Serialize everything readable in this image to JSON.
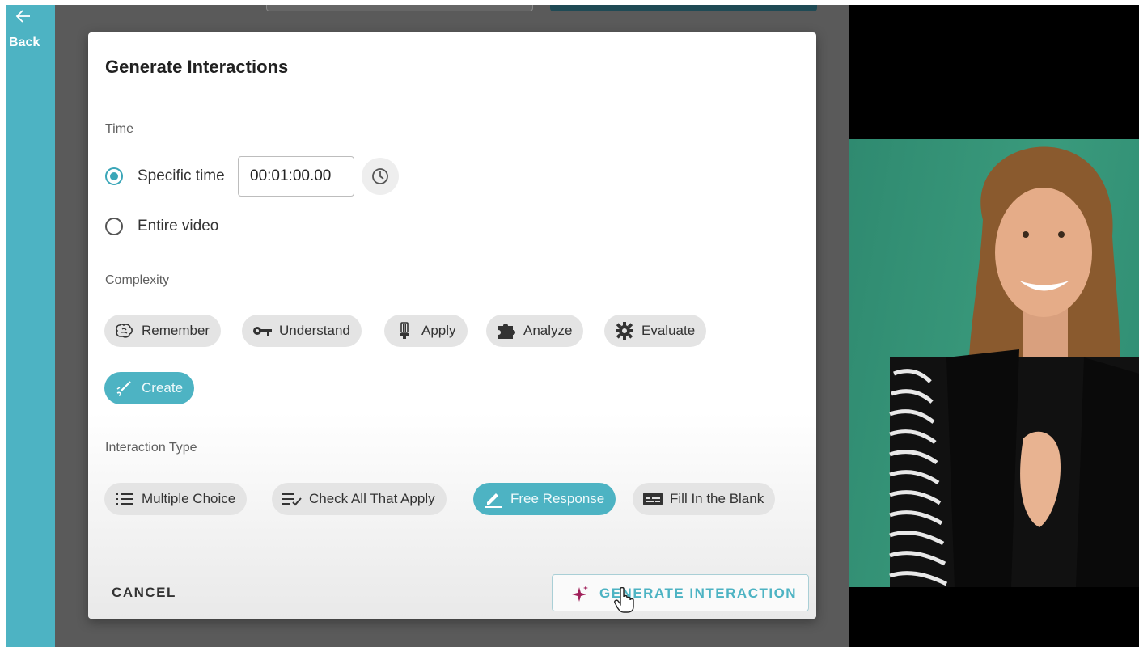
{
  "nav": {
    "back_label": "Back"
  },
  "dialog": {
    "title": "Generate Interactions",
    "time": {
      "label": "Time",
      "options": [
        "Specific time",
        "Entire video"
      ],
      "selected": "Specific time",
      "value": "00:01:00.00"
    },
    "complexity": {
      "label": "Complexity",
      "chips": [
        {
          "label": "Remember",
          "icon": "brain-icon"
        },
        {
          "label": "Understand",
          "icon": "key-icon"
        },
        {
          "label": "Apply",
          "icon": "lightbulb-icon"
        },
        {
          "label": "Analyze",
          "icon": "puzzle-icon"
        },
        {
          "label": "Evaluate",
          "icon": "gear-icon"
        },
        {
          "label": "Create",
          "icon": "creative-icon"
        }
      ],
      "selected": "Create"
    },
    "interaction_type": {
      "label": "Interaction Type",
      "chips": [
        {
          "label": "Multiple Choice",
          "icon": "list-icon"
        },
        {
          "label": "Check All That Apply",
          "icon": "checklist-icon"
        },
        {
          "label": "Free Response",
          "icon": "pencil-icon"
        },
        {
          "label": "Fill In the Blank",
          "icon": "blank-field-icon"
        }
      ],
      "selected": "Free Response"
    },
    "cancel_label": "CANCEL",
    "generate_label": "GENERATE INTERACTION"
  },
  "colors": {
    "accent": "#4db3c3",
    "backdrop": "#5a5a5a",
    "video_green": "#3a9a7c",
    "sparkle": "#a0205a"
  }
}
